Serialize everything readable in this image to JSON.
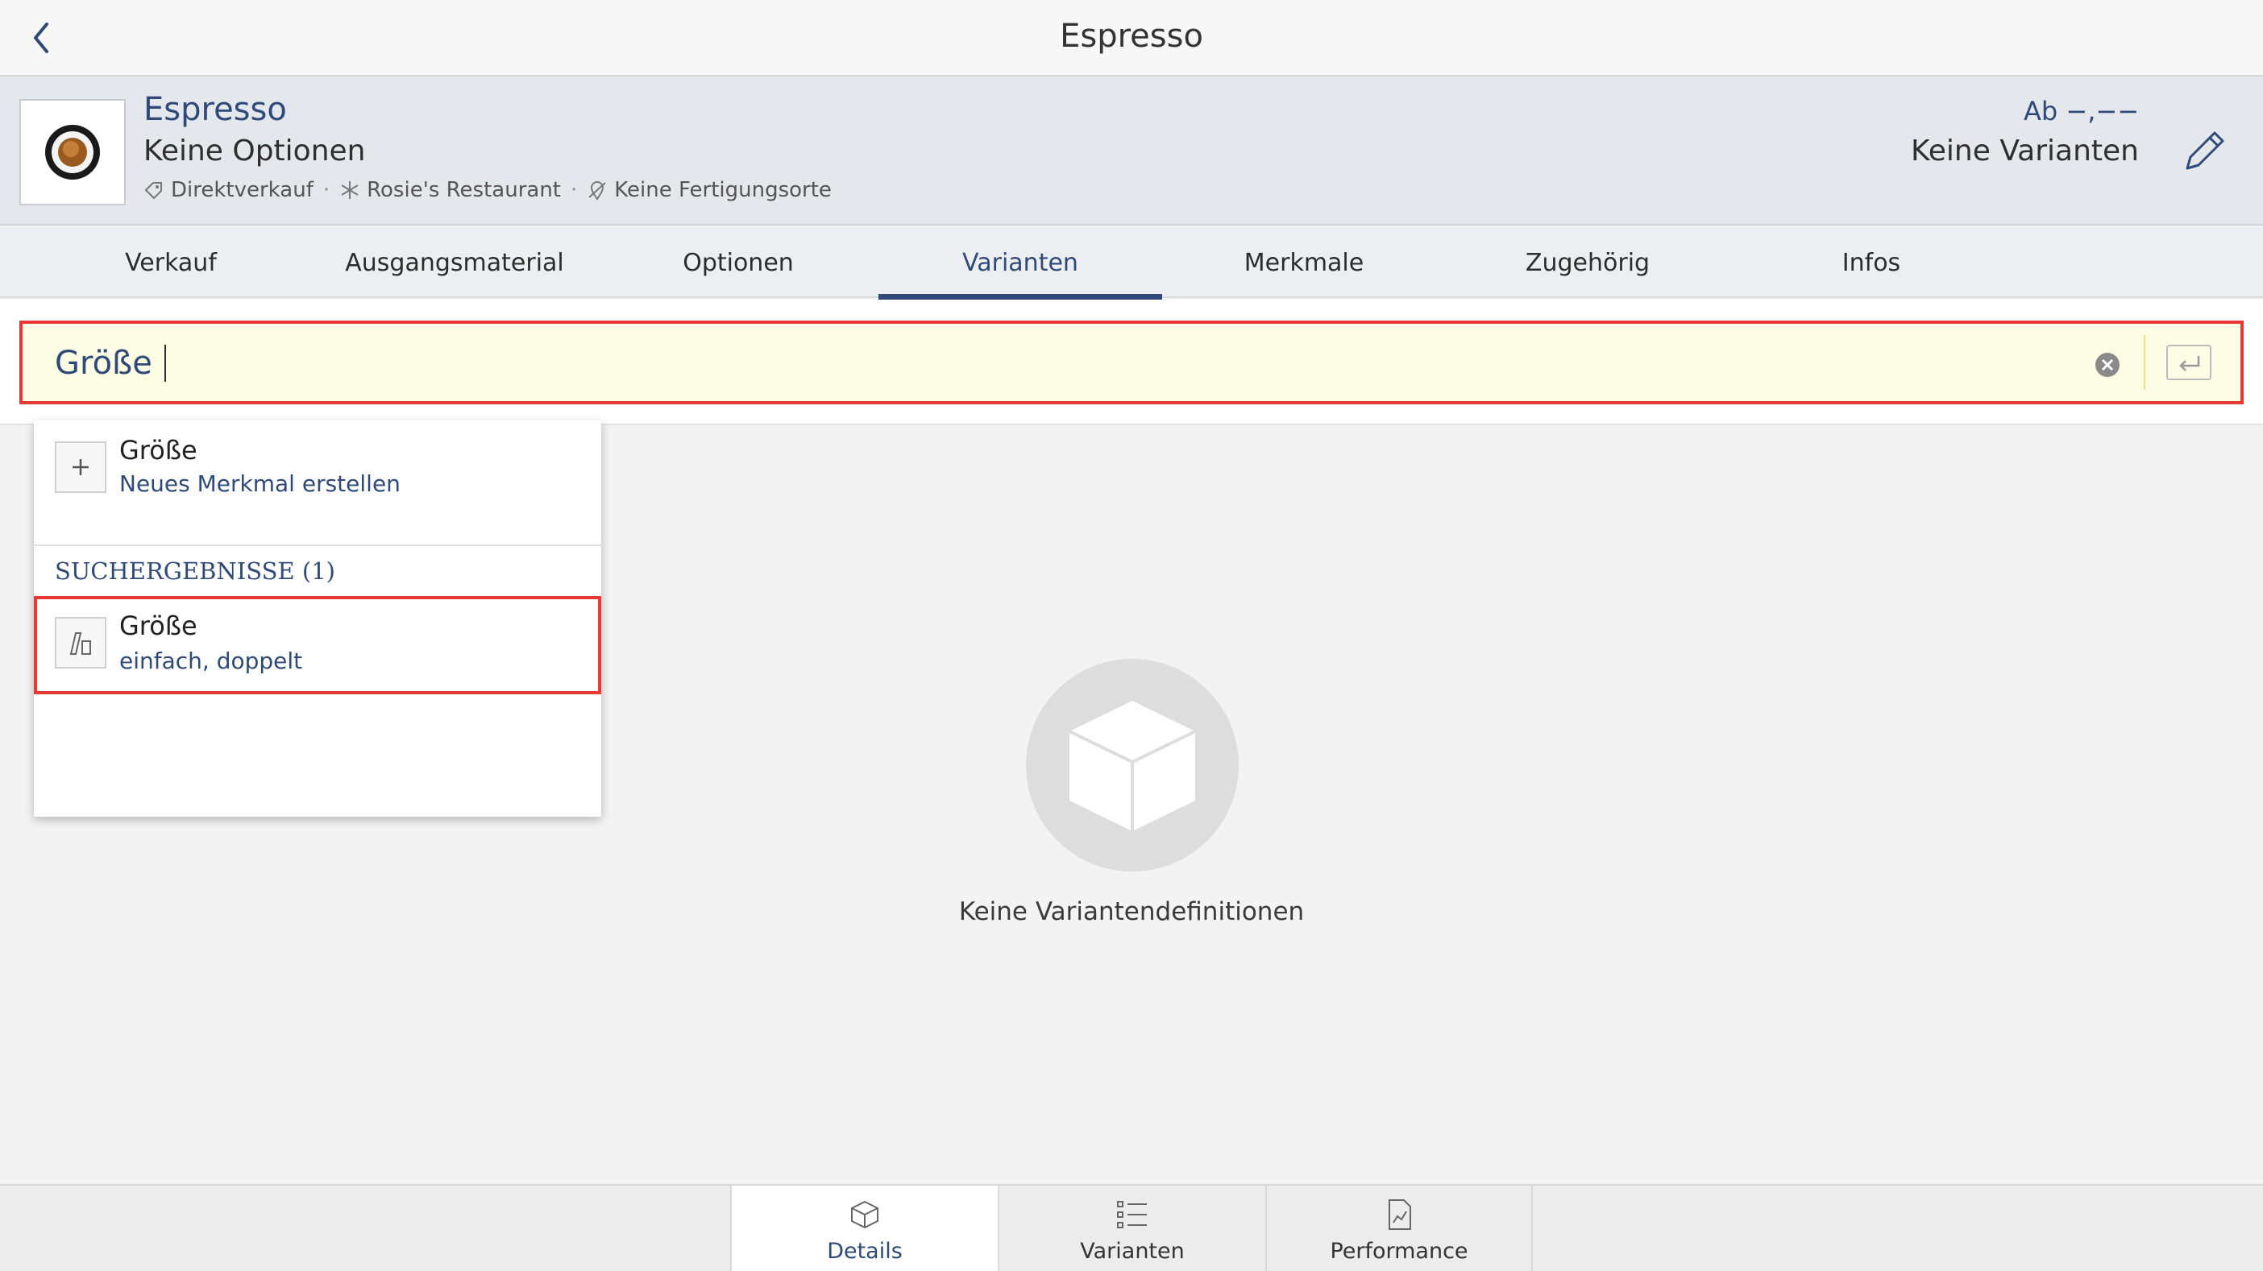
{
  "topbar": {
    "title": "Espresso"
  },
  "product": {
    "name": "Espresso",
    "options": "Keine Optionen",
    "meta": {
      "sale": "Direktverkauf",
      "restaurant": "Rosie's Restaurant",
      "production": "Keine Fertigungsorte"
    },
    "price": "Ab −,−−",
    "variants": "Keine Varianten"
  },
  "tabs": [
    "Verkauf",
    "Ausgangsmaterial",
    "Optionen",
    "Varianten",
    "Merkmale",
    "Zugehörig",
    "Infos"
  ],
  "active_tab": "Varianten",
  "search": {
    "value": "Größe"
  },
  "dropdown": {
    "create": {
      "title": "Größe",
      "subtitle": "Neues Merkmal erstellen"
    },
    "section": "SUCHERGEBNISSE (1)",
    "result": {
      "title": "Größe",
      "subtitle": "einfach, doppelt"
    }
  },
  "empty_state": {
    "text": "Keine Variantendefinitionen"
  },
  "bottom_tabs": [
    "Details",
    "Varianten",
    "Performance"
  ],
  "active_bottom_tab": "Details",
  "colors": {
    "accent": "#2f4a78",
    "highlight": "#e53935",
    "search_bg": "#fdfde6"
  }
}
